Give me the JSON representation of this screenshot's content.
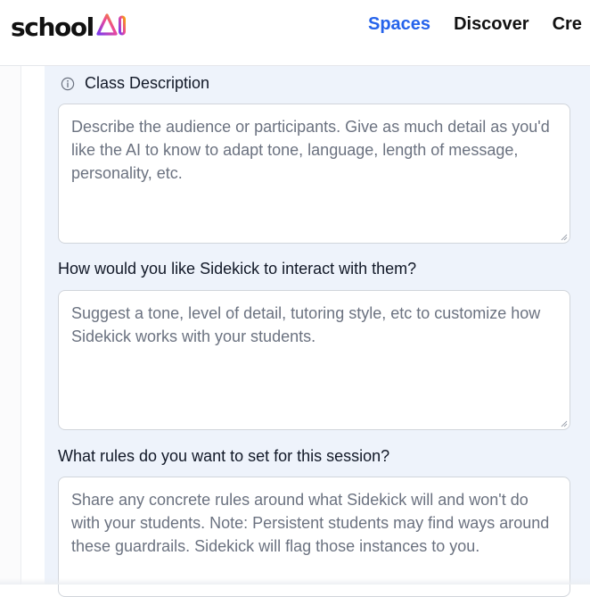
{
  "header": {
    "logo_text": "school",
    "logo_mark_text": "AI",
    "nav": [
      {
        "label": "Spaces",
        "active": true
      },
      {
        "label": "Discover",
        "active": false
      },
      {
        "label": "Cre",
        "active": false
      }
    ]
  },
  "form": {
    "class_description": {
      "label": "Class Description",
      "icon": "info-icon",
      "placeholder": "Describe the audience or participants. Give as much detail as you'd like the AI to know to adapt tone, language, length of message, personality, etc."
    },
    "interaction": {
      "label": "How would you like Sidekick to interact with them?",
      "placeholder": "Suggest a tone, level of detail, tutoring style, etc to customize how Sidekick works with your students."
    },
    "rules": {
      "label": "What rules do you want to set for this session?",
      "placeholder": "Share any concrete rules around what Sidekick will and won't do with your students. Note: Persistent students may find ways around these guardrails. Sidekick will flag those instances to you."
    }
  },
  "colors": {
    "accent": "#2563eb",
    "panel_background": "#eef3fb",
    "logo_gradient": [
      "#f59e0b",
      "#ec4899",
      "#7c3aed"
    ]
  }
}
